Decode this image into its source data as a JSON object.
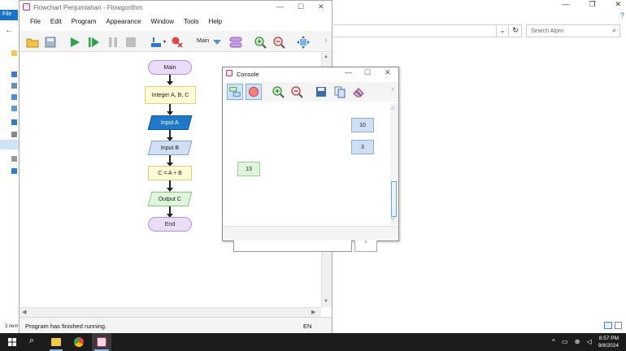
{
  "explorer": {
    "file_tab": "File",
    "search_placeholder": "Search Alpro",
    "items_count": "3 item",
    "controls": [
      "—",
      "❐",
      "✕"
    ]
  },
  "flowgorithm": {
    "title": "Flowchart Penjumlahan - Flowgorithm",
    "menu": [
      "File",
      "Edit",
      "Program",
      "Appearance",
      "Window",
      "Tools",
      "Help"
    ],
    "toolbar": {
      "function_select": "Main"
    },
    "status": "Program has finished running.",
    "language": "EN",
    "flowchart": {
      "start": "Main",
      "declare": "Integer A, B, C",
      "input_a": "Input A",
      "input_b": "Input B",
      "assign": "C = A + B",
      "output": "Output C",
      "end": "End"
    }
  },
  "console": {
    "title": "Console",
    "inputs": [
      "10",
      "3"
    ],
    "output": "13"
  },
  "taskbar": {
    "time": "8:57 PM",
    "date": "9/8/2024"
  },
  "colors": {
    "taskbar": "#1c1c1c",
    "accent": "#1a73c8",
    "terminal_fill": "#eadcf7",
    "declare_fill": "#fffbd6",
    "input_a_fill": "#1f78c8",
    "input_b_fill": "#cfe0f5",
    "output_fill": "#dff5dc"
  }
}
